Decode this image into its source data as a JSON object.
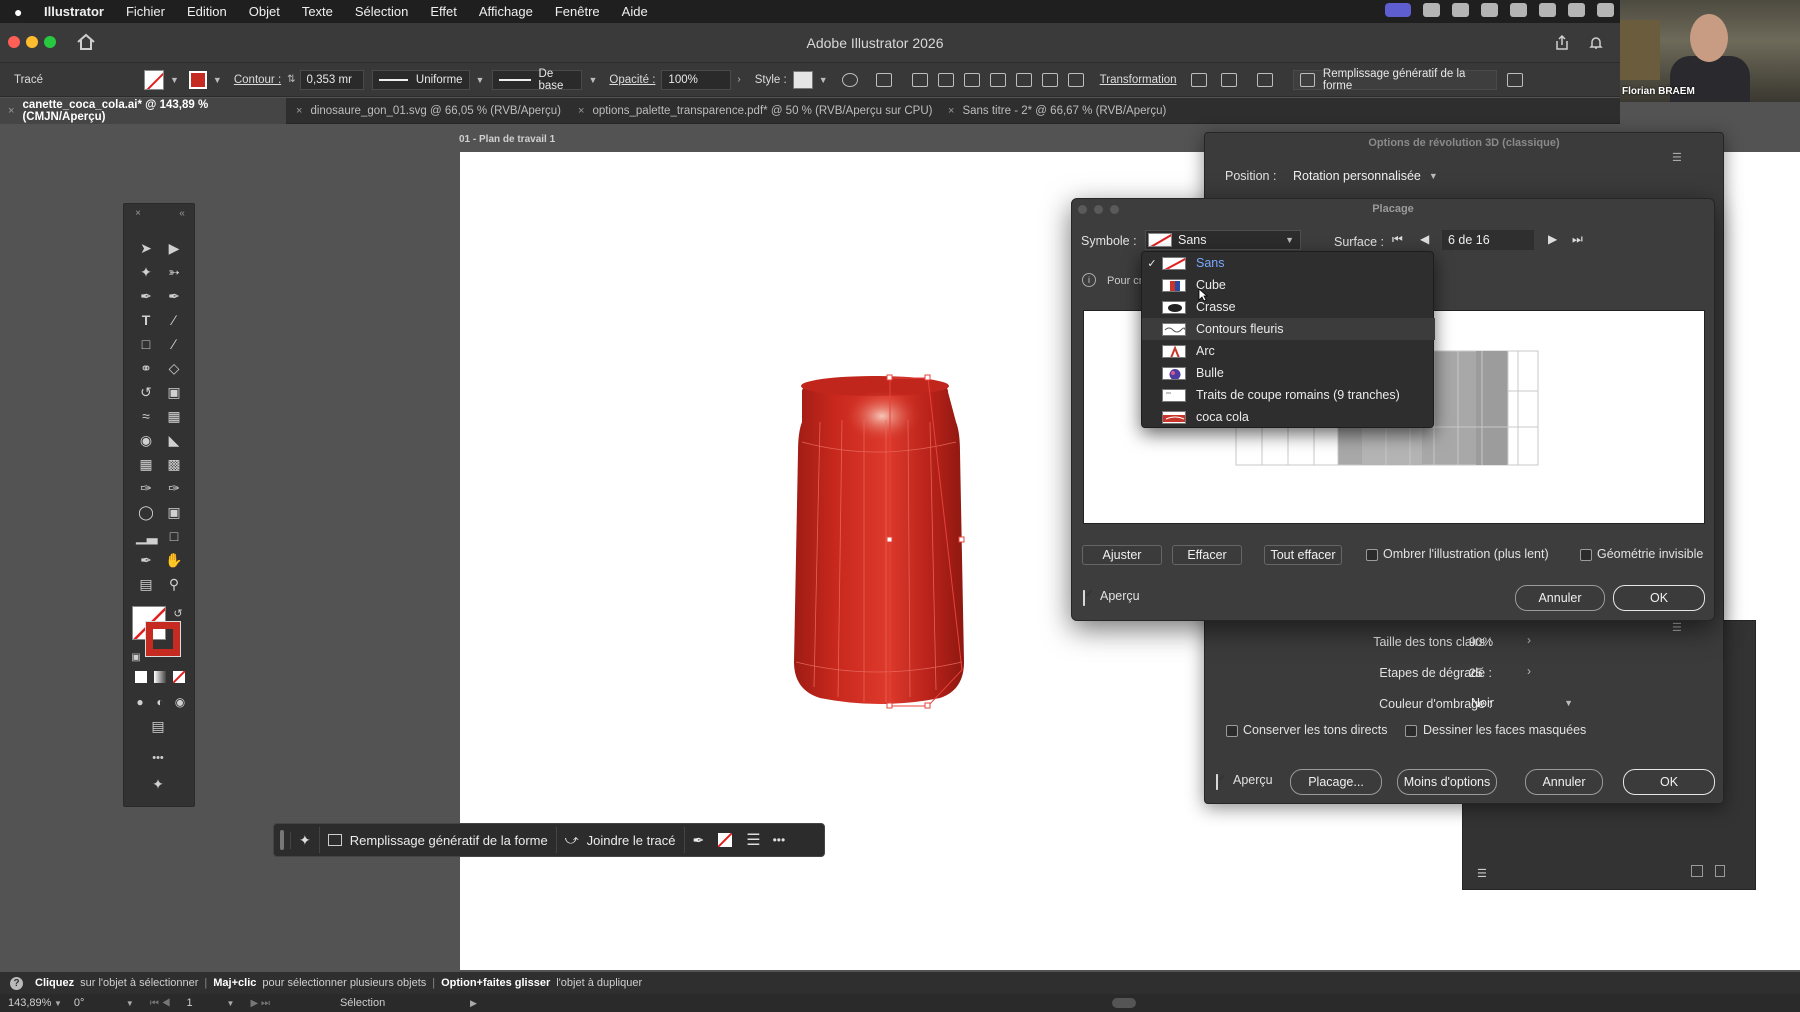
{
  "menubar": {
    "apple": "",
    "items": [
      "Illustrator",
      "Fichier",
      "Edition",
      "Objet",
      "Texte",
      "Sélection",
      "Effet",
      "Affichage",
      "Fenêtre",
      "Aide"
    ]
  },
  "window": {
    "title": "Adobe Illustrator 2026"
  },
  "webcam": {
    "name": "Florian BRAEM"
  },
  "controlbar": {
    "object_type": "Tracé",
    "contour_label": "Contour :",
    "contour_value": "0,353 mr",
    "profile": "Uniforme",
    "brush": "De base",
    "opacity_label": "Opacité :",
    "opacity_value": "100%",
    "style_label": "Style :",
    "transform_label": "Transformation",
    "genfill_label": "Remplissage génératif de la forme"
  },
  "tabs": [
    {
      "label": "canette_coca_cola.ai* @ 143,89 % (CMJN/Aperçu)",
      "close": "×"
    },
    {
      "label": "dinosaure_gon_01.svg @ 66,05 % (RVB/Aperçu)",
      "close": "×"
    },
    {
      "label": "options_palette_transparence.pdf* @ 50 % (RVB/Aperçu sur CPU)",
      "close": "×"
    },
    {
      "label": "Sans titre - 2* @ 66,67 % (RVB/Aperçu)",
      "close": "×"
    }
  ],
  "artboard": {
    "label": "01 - Plan de travail 1"
  },
  "contextbar": {
    "genfill": "Remplissage génératif de la forme",
    "join": "Joindre le tracé",
    "more": "•••"
  },
  "revolve_panel": {
    "title": "Options de révolution 3D (classique)",
    "position_label": "Position :",
    "position_value": "Rotation personnalisée",
    "highlight_size_label": "Taille des tons clairs :",
    "highlight_size_value": "90%",
    "blend_steps_label": "Etapes de dégradé :",
    "blend_steps_value": "25",
    "shading_color_label": "Couleur d'ombrage :",
    "shading_color_value": "Noir",
    "preserve_spot": "Conserver les tons directs",
    "draw_hidden": "Dessiner les faces masquées",
    "preview": "Aperçu",
    "map_button": "Placage...",
    "fewer_options": "Moins d'options",
    "cancel": "Annuler",
    "ok": "OK"
  },
  "placage": {
    "title": "Placage",
    "symbol_label": "Symbole :",
    "symbol_value": "Sans",
    "surface_label": "Surface :",
    "surface_value": "6 de 16",
    "info_text": "Pour cr",
    "adjust": "Ajuster",
    "clear": "Effacer",
    "clear_all": "Tout effacer",
    "shade_artwork": "Ombrer l'illustration (plus lent)",
    "invisible_geometry": "Géométrie invisible",
    "preview": "Aperçu",
    "cancel": "Annuler",
    "ok": "OK",
    "symbols": [
      "Sans",
      "Cube",
      "Crasse",
      "Contours fleuris",
      "Arc",
      "Bulle",
      "Traits de coupe romains (9 tranches)",
      "coca cola"
    ],
    "selected_index": 0
  },
  "hintbar": {
    "p1_bold": "Cliquez",
    "p1": "sur l'objet à sélectionner",
    "p2_bold": "Maj+clic",
    "p2": "pour sélectionner plusieurs objets",
    "p3_bold": "Option+faites glisser",
    "p3": "l'objet à dupliquer"
  },
  "statusbar": {
    "zoom": "143,89%",
    "rotation": "0°",
    "artboard_num": "1",
    "tool": "Sélection"
  },
  "colors": {
    "can_red": "#c8291f",
    "selection": "#e8413a",
    "accent_blue": "#7aa8ff"
  }
}
